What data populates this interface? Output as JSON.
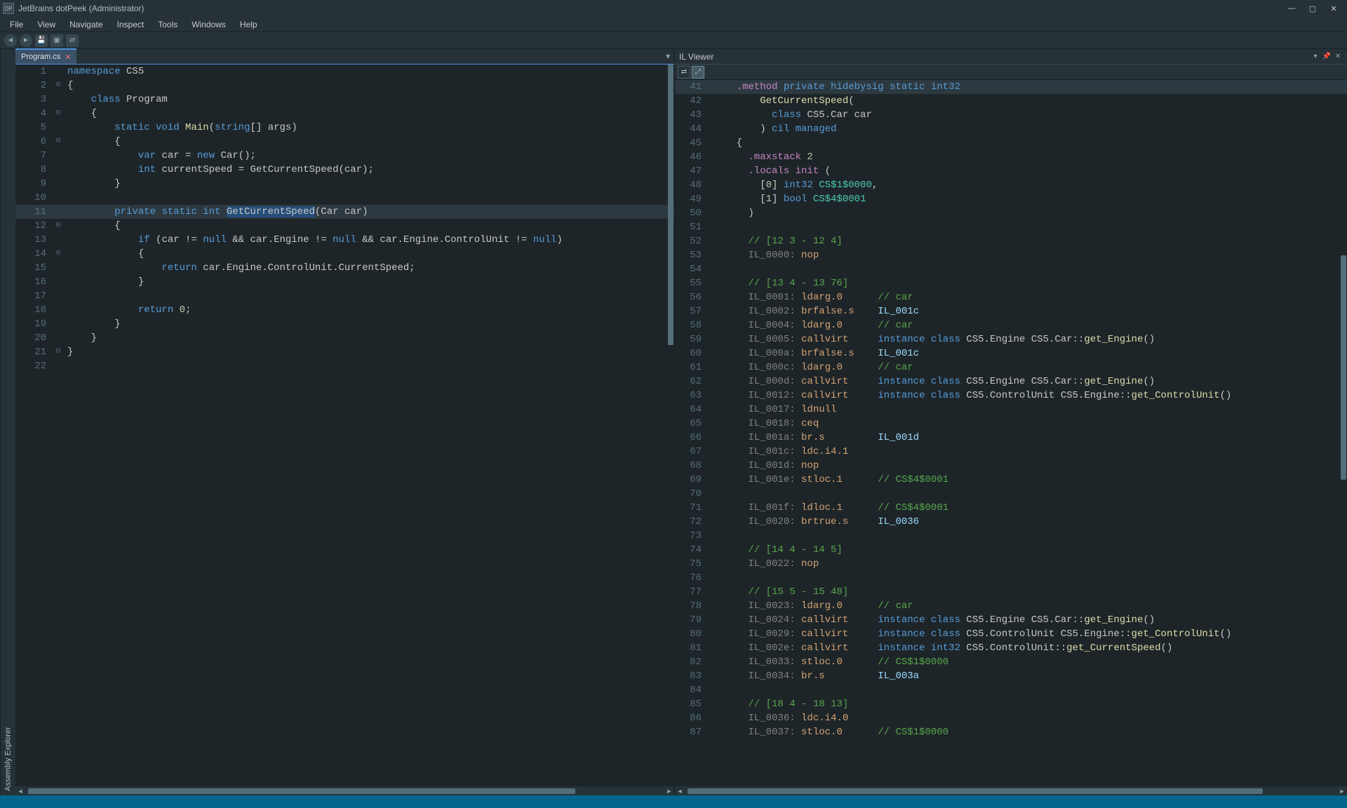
{
  "window": {
    "title": "JetBrains dotPeek (Administrator)",
    "app_icon_text": "DP"
  },
  "menu": [
    "File",
    "View",
    "Navigate",
    "Inspect",
    "Tools",
    "Windows",
    "Help"
  ],
  "toolbar_icons": [
    "back",
    "forward",
    "save",
    "cube",
    "link"
  ],
  "side_tab": "Assembly Explorer",
  "tabs": {
    "active": "Program.cs"
  },
  "il_viewer": {
    "title": "IL Viewer"
  },
  "csharp_lines": [
    {
      "n": 1,
      "indent": 0,
      "fold": "",
      "tokens": [
        [
          "kw",
          "namespace"
        ],
        [
          "id",
          " CS5"
        ]
      ]
    },
    {
      "n": 2,
      "indent": 0,
      "fold": "⊟",
      "tokens": [
        [
          "op",
          "{"
        ]
      ]
    },
    {
      "n": 3,
      "indent": 1,
      "fold": "",
      "tokens": [
        [
          "kw",
          "class"
        ],
        [
          "id",
          " Program"
        ]
      ]
    },
    {
      "n": 4,
      "indent": 1,
      "fold": "⊟",
      "tokens": [
        [
          "op",
          "{"
        ]
      ]
    },
    {
      "n": 5,
      "indent": 2,
      "fold": "",
      "tokens": [
        [
          "kw",
          "static "
        ],
        [
          "kw",
          "void"
        ],
        [
          "mtd",
          " Main"
        ],
        [
          "op",
          "("
        ],
        [
          "kw",
          "string"
        ],
        [
          "op",
          "[] "
        ],
        [
          "id",
          "args"
        ],
        [
          "op",
          ")"
        ]
      ]
    },
    {
      "n": 6,
      "indent": 2,
      "fold": "⊟",
      "tokens": [
        [
          "op",
          "{"
        ]
      ]
    },
    {
      "n": 7,
      "indent": 3,
      "fold": "",
      "tokens": [
        [
          "kw",
          "var"
        ],
        [
          "id",
          " car = "
        ],
        [
          "kw",
          "new"
        ],
        [
          "id",
          " Car();"
        ]
      ]
    },
    {
      "n": 8,
      "indent": 3,
      "fold": "",
      "tokens": [
        [
          "kw",
          "int"
        ],
        [
          "id",
          " currentSpeed = GetCurrentSpeed(car);"
        ]
      ]
    },
    {
      "n": 9,
      "indent": 2,
      "fold": "",
      "tokens": [
        [
          "op",
          "}"
        ]
      ]
    },
    {
      "n": 10,
      "indent": 0,
      "fold": "",
      "tokens": []
    },
    {
      "n": 11,
      "indent": 2,
      "fold": "",
      "hl": true,
      "tokens": [
        [
          "kw",
          "private "
        ],
        [
          "kw",
          "static "
        ],
        [
          "kw",
          "int "
        ],
        [
          "sel",
          "GetCurrentSpeed"
        ],
        [
          "op",
          "(Car car)"
        ]
      ]
    },
    {
      "n": 12,
      "indent": 2,
      "fold": "⊟",
      "tokens": [
        [
          "op",
          "{"
        ]
      ]
    },
    {
      "n": 13,
      "indent": 3,
      "fold": "",
      "tokens": [
        [
          "kw",
          "if"
        ],
        [
          "op",
          " (car != "
        ],
        [
          "kw",
          "null"
        ],
        [
          "op",
          " && car.Engine != "
        ],
        [
          "kw",
          "null"
        ],
        [
          "op",
          " && car.Engine.ControlUnit != "
        ],
        [
          "kw",
          "null"
        ],
        [
          "op",
          ")"
        ]
      ]
    },
    {
      "n": 14,
      "indent": 3,
      "fold": "⊟",
      "tokens": [
        [
          "op",
          "{"
        ]
      ]
    },
    {
      "n": 15,
      "indent": 4,
      "fold": "",
      "tokens": [
        [
          "kw",
          "return"
        ],
        [
          "id",
          " car.Engine.ControlUnit.CurrentSpeed;"
        ]
      ]
    },
    {
      "n": 16,
      "indent": 3,
      "fold": "",
      "tokens": [
        [
          "op",
          "}"
        ]
      ]
    },
    {
      "n": 17,
      "indent": 0,
      "fold": "",
      "tokens": []
    },
    {
      "n": 18,
      "indent": 3,
      "fold": "",
      "tokens": [
        [
          "kw",
          "return"
        ],
        [
          "id",
          " "
        ],
        [
          "num",
          "0"
        ],
        [
          "op",
          ";"
        ]
      ]
    },
    {
      "n": 19,
      "indent": 2,
      "fold": "",
      "tokens": [
        [
          "op",
          "}"
        ]
      ]
    },
    {
      "n": 20,
      "indent": 1,
      "fold": "",
      "tokens": [
        [
          "op",
          "}"
        ]
      ]
    },
    {
      "n": 21,
      "indent": 0,
      "fold": "⊟",
      "tokens": [
        [
          "op",
          "}"
        ]
      ]
    },
    {
      "n": 22,
      "indent": 0,
      "fold": "",
      "tokens": []
    }
  ],
  "il_lines": [
    {
      "n": 41,
      "hl": true,
      "tokens": [
        [
          "il-kw",
          "    .method "
        ],
        [
          "kw",
          "private "
        ],
        [
          "kw",
          "hidebysig "
        ],
        [
          "kw",
          "static "
        ],
        [
          "kw",
          "int32"
        ]
      ]
    },
    {
      "n": 42,
      "tokens": [
        [
          "mtd",
          "        GetCurrentSpeed"
        ],
        [
          "op",
          "("
        ]
      ]
    },
    {
      "n": 43,
      "tokens": [
        [
          "kw",
          "          class "
        ],
        [
          "id",
          "CS5.Car "
        ],
        [
          "id",
          "car"
        ]
      ]
    },
    {
      "n": 44,
      "tokens": [
        [
          "op",
          "        ) "
        ],
        [
          "kw",
          "cil managed"
        ]
      ]
    },
    {
      "n": 45,
      "tokens": [
        [
          "op",
          "    {"
        ]
      ]
    },
    {
      "n": 46,
      "tokens": [
        [
          "il-kw",
          "      .maxstack "
        ],
        [
          "num",
          "2"
        ]
      ]
    },
    {
      "n": 47,
      "tokens": [
        [
          "il-kw",
          "      .locals init"
        ],
        [
          "op",
          " ("
        ]
      ]
    },
    {
      "n": 48,
      "tokens": [
        [
          "op",
          "        ["
        ],
        [
          "num",
          "0"
        ],
        [
          "op",
          "] "
        ],
        [
          "kw",
          "int32"
        ],
        [
          "type",
          " CS$1$0000"
        ],
        [
          "op",
          ","
        ]
      ]
    },
    {
      "n": 49,
      "tokens": [
        [
          "op",
          "        ["
        ],
        [
          "num",
          "1"
        ],
        [
          "op",
          "] "
        ],
        [
          "kw",
          "bool"
        ],
        [
          "type",
          " CS$4$0001"
        ]
      ]
    },
    {
      "n": 50,
      "tokens": [
        [
          "op",
          "      )"
        ]
      ]
    },
    {
      "n": 51,
      "tokens": []
    },
    {
      "n": 52,
      "tokens": [
        [
          "com",
          "      // [12 3 - 12 4]"
        ]
      ]
    },
    {
      "n": 53,
      "tokens": [
        [
          "il-label-gray",
          "      IL_0000: "
        ],
        [
          "il-instr",
          "nop"
        ]
      ]
    },
    {
      "n": 54,
      "tokens": []
    },
    {
      "n": 55,
      "tokens": [
        [
          "com",
          "      // [13 4 - 13 76]"
        ]
      ]
    },
    {
      "n": 56,
      "tokens": [
        [
          "il-label-gray",
          "      IL_0001: "
        ],
        [
          "il-instr",
          "ldarg.0"
        ],
        [
          "com",
          "      // car"
        ]
      ]
    },
    {
      "n": 57,
      "tokens": [
        [
          "il-label-gray",
          "      IL_0002: "
        ],
        [
          "il-instr",
          "brfalse.s"
        ],
        [
          "il-target",
          "    IL_001c"
        ]
      ]
    },
    {
      "n": 58,
      "tokens": [
        [
          "il-label-gray",
          "      IL_0004: "
        ],
        [
          "il-instr",
          "ldarg.0"
        ],
        [
          "com",
          "      // car"
        ]
      ]
    },
    {
      "n": 59,
      "tokens": [
        [
          "il-label-gray",
          "      IL_0005: "
        ],
        [
          "il-instr",
          "callvirt"
        ],
        [
          "op",
          "     "
        ],
        [
          "kw",
          "instance class "
        ],
        [
          "id",
          "CS5.Engine CS5.Car::"
        ],
        [
          "mtd",
          "get_Engine"
        ],
        [
          "op",
          "()"
        ]
      ]
    },
    {
      "n": 60,
      "tokens": [
        [
          "il-label-gray",
          "      IL_000a: "
        ],
        [
          "il-instr",
          "brfalse.s"
        ],
        [
          "il-target",
          "    IL_001c"
        ]
      ]
    },
    {
      "n": 61,
      "tokens": [
        [
          "il-label-gray",
          "      IL_000c: "
        ],
        [
          "il-instr",
          "ldarg.0"
        ],
        [
          "com",
          "      // car"
        ]
      ]
    },
    {
      "n": 62,
      "tokens": [
        [
          "il-label-gray",
          "      IL_000d: "
        ],
        [
          "il-instr",
          "callvirt"
        ],
        [
          "op",
          "     "
        ],
        [
          "kw",
          "instance class "
        ],
        [
          "id",
          "CS5.Engine CS5.Car::"
        ],
        [
          "mtd",
          "get_Engine"
        ],
        [
          "op",
          "()"
        ]
      ]
    },
    {
      "n": 63,
      "tokens": [
        [
          "il-label-gray",
          "      IL_0012: "
        ],
        [
          "il-instr",
          "callvirt"
        ],
        [
          "op",
          "     "
        ],
        [
          "kw",
          "instance class "
        ],
        [
          "id",
          "CS5.ControlUnit CS5.Engine::"
        ],
        [
          "mtd",
          "get_ControlUnit"
        ],
        [
          "op",
          "()"
        ]
      ]
    },
    {
      "n": 64,
      "tokens": [
        [
          "il-label-gray",
          "      IL_0017: "
        ],
        [
          "il-instr",
          "ldnull"
        ]
      ]
    },
    {
      "n": 65,
      "tokens": [
        [
          "il-label-gray",
          "      IL_0018: "
        ],
        [
          "il-instr",
          "ceq"
        ]
      ]
    },
    {
      "n": 66,
      "tokens": [
        [
          "il-label-gray",
          "      IL_001a: "
        ],
        [
          "il-instr",
          "br.s"
        ],
        [
          "il-target",
          "         IL_001d"
        ]
      ]
    },
    {
      "n": 67,
      "tokens": [
        [
          "il-label-gray",
          "      IL_001c: "
        ],
        [
          "il-instr",
          "ldc.i4.1"
        ]
      ]
    },
    {
      "n": 68,
      "tokens": [
        [
          "il-label-gray",
          "      IL_001d: "
        ],
        [
          "il-instr",
          "nop"
        ]
      ]
    },
    {
      "n": 69,
      "tokens": [
        [
          "il-label-gray",
          "      IL_001e: "
        ],
        [
          "il-instr",
          "stloc.1"
        ],
        [
          "com",
          "      // CS$4$0001"
        ]
      ]
    },
    {
      "n": 70,
      "tokens": []
    },
    {
      "n": 71,
      "tokens": [
        [
          "il-label-gray",
          "      IL_001f: "
        ],
        [
          "il-instr",
          "ldloc.1"
        ],
        [
          "com",
          "      // CS$4$0001"
        ]
      ]
    },
    {
      "n": 72,
      "tokens": [
        [
          "il-label-gray",
          "      IL_0020: "
        ],
        [
          "il-instr",
          "brtrue.s"
        ],
        [
          "il-target",
          "     IL_0036"
        ]
      ]
    },
    {
      "n": 73,
      "tokens": []
    },
    {
      "n": 74,
      "tokens": [
        [
          "com",
          "      // [14 4 - 14 5]"
        ]
      ]
    },
    {
      "n": 75,
      "tokens": [
        [
          "il-label-gray",
          "      IL_0022: "
        ],
        [
          "il-instr",
          "nop"
        ]
      ]
    },
    {
      "n": 76,
      "tokens": []
    },
    {
      "n": 77,
      "tokens": [
        [
          "com",
          "      // [15 5 - 15 48]"
        ]
      ]
    },
    {
      "n": 78,
      "tokens": [
        [
          "il-label-gray",
          "      IL_0023: "
        ],
        [
          "il-instr",
          "ldarg.0"
        ],
        [
          "com",
          "      // car"
        ]
      ]
    },
    {
      "n": 79,
      "tokens": [
        [
          "il-label-gray",
          "      IL_0024: "
        ],
        [
          "il-instr",
          "callvirt"
        ],
        [
          "op",
          "     "
        ],
        [
          "kw",
          "instance class "
        ],
        [
          "id",
          "CS5.Engine CS5.Car::"
        ],
        [
          "mtd",
          "get_Engine"
        ],
        [
          "op",
          "()"
        ]
      ]
    },
    {
      "n": 80,
      "tokens": [
        [
          "il-label-gray",
          "      IL_0029: "
        ],
        [
          "il-instr",
          "callvirt"
        ],
        [
          "op",
          "     "
        ],
        [
          "kw",
          "instance class "
        ],
        [
          "id",
          "CS5.ControlUnit CS5.Engine::"
        ],
        [
          "mtd",
          "get_ControlUnit"
        ],
        [
          "op",
          "()"
        ]
      ]
    },
    {
      "n": 81,
      "tokens": [
        [
          "il-label-gray",
          "      IL_002e: "
        ],
        [
          "il-instr",
          "callvirt"
        ],
        [
          "op",
          "     "
        ],
        [
          "kw",
          "instance int32 "
        ],
        [
          "id",
          "CS5.ControlUnit::"
        ],
        [
          "mtd",
          "get_CurrentSpeed"
        ],
        [
          "op",
          "()"
        ]
      ]
    },
    {
      "n": 82,
      "tokens": [
        [
          "il-label-gray",
          "      IL_0033: "
        ],
        [
          "il-instr",
          "stloc.0"
        ],
        [
          "com",
          "      // CS$1$0000"
        ]
      ]
    },
    {
      "n": 83,
      "tokens": [
        [
          "il-label-gray",
          "      IL_0034: "
        ],
        [
          "il-instr",
          "br.s"
        ],
        [
          "il-target",
          "         IL_003a"
        ]
      ]
    },
    {
      "n": 84,
      "tokens": []
    },
    {
      "n": 85,
      "tokens": [
        [
          "com",
          "      // [18 4 - 18 13]"
        ]
      ]
    },
    {
      "n": 86,
      "tokens": [
        [
          "il-label-gray",
          "      IL_0036: "
        ],
        [
          "il-instr",
          "ldc.i4.0"
        ]
      ]
    },
    {
      "n": 87,
      "tokens": [
        [
          "il-label-gray",
          "      IL_0037: "
        ],
        [
          "il-instr",
          "stloc.0"
        ],
        [
          "com",
          "      // CS$1$0000"
        ]
      ]
    }
  ]
}
